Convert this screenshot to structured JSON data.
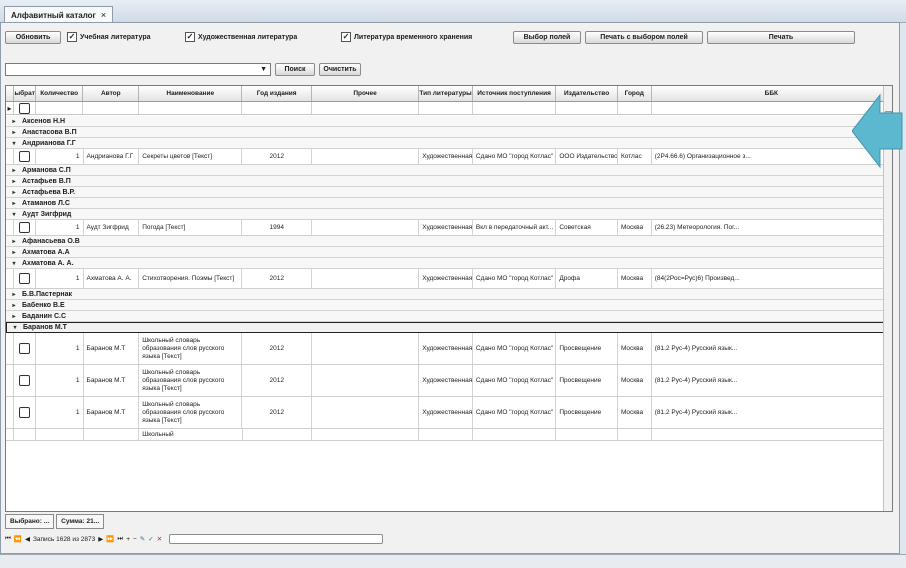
{
  "document_tab": {
    "title": "Алфавитный каталог",
    "close": "×"
  },
  "toolbar": {
    "refresh": "Обновить",
    "check_uchebnaya": "Учебная литература",
    "check_hudozh": "Художественная литература",
    "check_periodic": "Литература временного хранения",
    "select_fields": "Выбор полей",
    "print_selected": "Печать с выбором полей",
    "print": "Печать"
  },
  "search": {
    "value": "",
    "find": "Поиск",
    "clear": "Очистить"
  },
  "columns": [
    "Выбрать",
    "Количество",
    "Автор",
    "Наименование",
    "Год издания",
    "Прочее",
    "Тип литературы",
    "Источник поступления",
    "Издательство",
    "Город",
    "ББК"
  ],
  "rows": [
    {
      "kind": "group",
      "label": "Аксенов Н.Н",
      "expanded": false
    },
    {
      "kind": "group",
      "label": "Анастасова В.П",
      "expanded": false
    },
    {
      "kind": "group",
      "label": "Андрианова Г.Г",
      "expanded": true
    },
    {
      "kind": "data",
      "qty": "1",
      "author": "Андрианова Г.Г",
      "title": "Секреты цветов [Текст]",
      "year": "2012",
      "type": "Художественная...",
      "source": "Сдано МО \"город Котлас\"",
      "publisher": "ООО Издательство...",
      "city": "Котлас",
      "bbk": "(2Р4.66.6) Организационное з..."
    },
    {
      "kind": "group",
      "label": "Арманова С.П",
      "expanded": false
    },
    {
      "kind": "group",
      "label": "Астафьев В.П",
      "expanded": false
    },
    {
      "kind": "group",
      "label": "Астафьева В.Р.",
      "expanded": false
    },
    {
      "kind": "group",
      "label": "Атаманов Л.С",
      "expanded": false
    },
    {
      "kind": "group",
      "label": "Аудт Зигфрид",
      "expanded": true
    },
    {
      "kind": "data",
      "qty": "1",
      "author": "Аудт Зигфрид",
      "title": "Погода [Текст]",
      "year": "1994",
      "type": "Художественная...",
      "source": "Вкл в передаточный акт...",
      "publisher": "Советская",
      "city": "Москва",
      "bbk": "(26.23) Метеорология. Пог..."
    },
    {
      "kind": "group",
      "label": "Афанасьева О.В",
      "expanded": false
    },
    {
      "kind": "group",
      "label": "Ахматова А.А",
      "expanded": false
    },
    {
      "kind": "group",
      "label": "Ахматова А. А.",
      "expanded": true
    },
    {
      "kind": "data",
      "qty": "1",
      "author": "Ахматова А. А.",
      "title": "Стихотворения. Поэмы [Текст]",
      "year": "2012",
      "type": "Художественная...",
      "source": "Сдано МО \"город Котлас\"",
      "publisher": "Дрофа",
      "city": "Москва",
      "bbk": "(84(2Рос=Рус)6) Произвед..."
    },
    {
      "kind": "group",
      "label": "Б.В.Пастернак",
      "expanded": false
    },
    {
      "kind": "group",
      "label": "Бабенко В.Е",
      "expanded": false
    },
    {
      "kind": "group",
      "label": "Баданин С.С",
      "expanded": false
    },
    {
      "kind": "group",
      "label": "Баранов М.Т",
      "expanded": true,
      "selected": true
    },
    {
      "kind": "data",
      "qty": "1",
      "author": "Баранов М.Т",
      "title": "Школьный словарь образования слов русского языка [Текст]",
      "year": "2012",
      "type": "Художественная...",
      "source": "Сдано МО \"город Котлас\"",
      "publisher": "Просвещение",
      "city": "Москва",
      "bbk": "(81.2 Рус-4) Русский язык..."
    },
    {
      "kind": "data",
      "qty": "1",
      "author": "Баранов М.Т",
      "title": "Школьный словарь образования слов русского языка [Текст]",
      "year": "2012",
      "type": "Художественная...",
      "source": "Сдано МО \"город Котлас\"",
      "publisher": "Просвещение",
      "city": "Москва",
      "bbk": "(81.2 Рус-4) Русский язык..."
    },
    {
      "kind": "data",
      "qty": "1",
      "author": "Баранов М.Т",
      "title": "Школьный словарь образования слов русского языка [Текст]",
      "year": "2012",
      "type": "Художественная...",
      "source": "Сдано МО \"город Котлас\"",
      "publisher": "Просвещение",
      "city": "Москва",
      "bbk": "(81.2 Рус-4) Русский язык..."
    }
  ],
  "partial_row_label": "Школьный",
  "subtabs": [
    "Выбрано: ...",
    "Сумма: 21..."
  ],
  "navigator": {
    "record_text": "Запись 1628 из 2873"
  },
  "colors": {
    "window_bg": "#f1f1f1",
    "accent_arrow": "#5bb8cf"
  },
  "icons": [
    "first-record-icon",
    "prev-page-icon",
    "prev-record-icon",
    "next-record-icon",
    "next-page-icon",
    "last-record-icon",
    "add-record-icon",
    "delete-record-icon",
    "edit-record-icon",
    "save-record-icon",
    "cancel-edit-icon"
  ]
}
